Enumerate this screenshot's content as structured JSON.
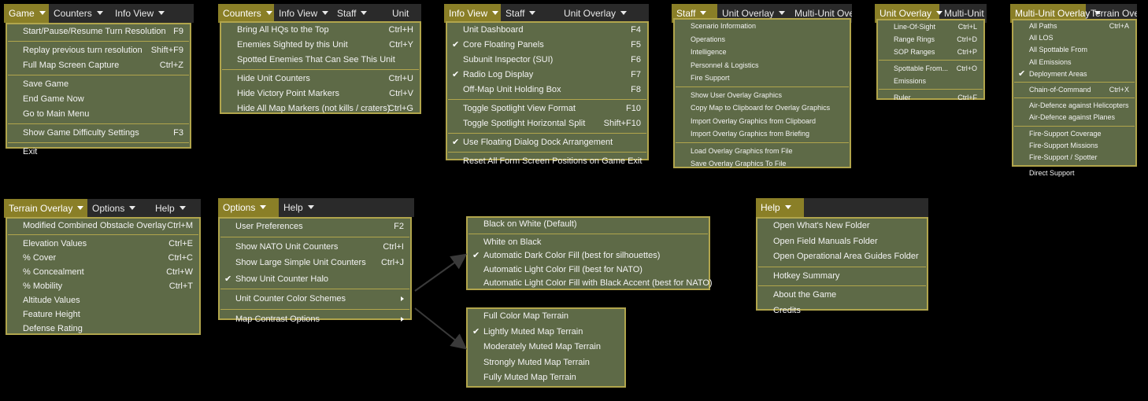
{
  "panels": [
    {
      "id": "game",
      "menubar": [
        {
          "label": "Game",
          "active": true
        },
        {
          "label": "Counters"
        },
        {
          "label": "Info View"
        }
      ],
      "items": [
        {
          "label": "Start/Pause/Resume Turn Resolution",
          "shortcut": "F9"
        },
        {
          "sep": true
        },
        {
          "label": "Replay previous turn resolution",
          "shortcut": "Shift+F9"
        },
        {
          "label": "Full Map Screen Capture",
          "shortcut": "Ctrl+Z"
        },
        {
          "sep": true
        },
        {
          "label": "Save Game"
        },
        {
          "label": "End Game Now"
        },
        {
          "label": "Go to Main Menu"
        },
        {
          "sep": true
        },
        {
          "label": "Show Game Difficulty Settings",
          "shortcut": "F3"
        },
        {
          "sep": true
        },
        {
          "label": "Exit"
        }
      ]
    },
    {
      "id": "counters",
      "menubar": [
        {
          "label": "Counters",
          "active": true
        },
        {
          "label": "Info View"
        },
        {
          "label": "Staff"
        },
        {
          "label": "Unit",
          "noarrow": true
        }
      ],
      "items": [
        {
          "label": "Bring All HQs to the Top",
          "shortcut": "Ctrl+H"
        },
        {
          "label": "Enemies Sighted by this Unit",
          "shortcut": "Ctrl+Y"
        },
        {
          "label": "Spotted Enemies That Can See This Unit"
        },
        {
          "sep": true
        },
        {
          "label": "Hide Unit Counters",
          "shortcut": "Ctrl+U"
        },
        {
          "label": "Hide Victory Point Markers",
          "shortcut": "Ctrl+V"
        },
        {
          "label": "Hide All Map Markers (not kills / craters)",
          "shortcut": "Ctrl+G"
        }
      ]
    },
    {
      "id": "infoview",
      "menubar": [
        {
          "label": "Info View",
          "active": true
        },
        {
          "label": "Staff"
        },
        {
          "label": "Unit Overlay"
        }
      ],
      "items": [
        {
          "label": "Unit Dashboard",
          "shortcut": "F4"
        },
        {
          "label": "Core Floating Panels",
          "shortcut": "F5",
          "checked": true
        },
        {
          "label": "Subunit Inspector (SUI)",
          "shortcut": "F6"
        },
        {
          "label": "Radio Log Display",
          "shortcut": "F7",
          "checked": true
        },
        {
          "label": "Off-Map Unit Holding Box",
          "shortcut": "F8"
        },
        {
          "sep": true
        },
        {
          "label": "Toggle Spotlight View Format",
          "shortcut": "F10"
        },
        {
          "label": "Toggle Spotlight Horizontal Split",
          "shortcut": "Shift+F10"
        },
        {
          "sep": true
        },
        {
          "label": "Use Floating Dialog Dock Arrangement",
          "checked": true
        },
        {
          "sep": true
        },
        {
          "label": "Reset All Form Screen Positions on Game Exit"
        }
      ]
    },
    {
      "id": "staff",
      "menubar": [
        {
          "label": "Staff",
          "active": true
        },
        {
          "label": "Unit Overlay"
        },
        {
          "label": "Multi-Unit Ove",
          "noarrow": true
        }
      ],
      "items": [
        {
          "label": "Scenario Information"
        },
        {
          "label": "Operations"
        },
        {
          "label": "Intelligence"
        },
        {
          "label": "Personnel & Logistics"
        },
        {
          "label": "Fire Support"
        },
        {
          "sep": true
        },
        {
          "label": "Show User Overlay Graphics"
        },
        {
          "label": "Copy Map to Clipboard for Overlay Graphics"
        },
        {
          "label": "Import Overlay Graphics from Clipboard"
        },
        {
          "label": "Import Overlay Graphics from Briefing"
        },
        {
          "sep": true
        },
        {
          "label": "Load Overlay Graphics from File"
        },
        {
          "label": "Save Overlay Graphics To File"
        }
      ]
    },
    {
      "id": "unitoverlay",
      "menubar": [
        {
          "label": "Unit Overlay",
          "active": true
        },
        {
          "label": "Multi-Unit",
          "noarrow": true
        }
      ],
      "items": [
        {
          "label": "Line-Of-Sight",
          "shortcut": "Ctrl+L"
        },
        {
          "label": "Range Rings",
          "shortcut": "Ctrl+D"
        },
        {
          "label": "SOP Ranges",
          "shortcut": "Ctrl+P"
        },
        {
          "sep": true
        },
        {
          "label": "Spottable From...",
          "shortcut": "Ctrl+O"
        },
        {
          "label": "Emissions"
        },
        {
          "sep": true
        },
        {
          "label": "Ruler",
          "shortcut": "Ctrl+F"
        }
      ]
    },
    {
      "id": "multiunit",
      "menubar": [
        {
          "label": "Multi-Unit Overlay",
          "active": true
        },
        {
          "label": "Terrain Ove",
          "noarrow": true
        }
      ],
      "items": [
        {
          "label": "All Paths",
          "shortcut": "Ctrl+A"
        },
        {
          "label": "All LOS"
        },
        {
          "label": "All Spottable From"
        },
        {
          "label": "All Emissions"
        },
        {
          "label": "Deployment Areas",
          "checked": true
        },
        {
          "sep": true
        },
        {
          "label": "Chain-of-Command",
          "shortcut": "Ctrl+X"
        },
        {
          "sep": true
        },
        {
          "label": "Air-Defence against Helicopters"
        },
        {
          "label": "Air-Defence against Planes"
        },
        {
          "sep": true
        },
        {
          "label": "Fire-Support Coverage"
        },
        {
          "label": "Fire-Support Missions"
        },
        {
          "label": "Fire-Support / Spotter"
        },
        {
          "sep": true
        },
        {
          "label": "Direct Support"
        }
      ]
    },
    {
      "id": "terrain",
      "menubar": [
        {
          "label": "Terrain Overlay",
          "active": true
        },
        {
          "label": "Options"
        },
        {
          "label": "Help"
        }
      ],
      "items": [
        {
          "label": "Modified Combined Obstacle Overlay",
          "shortcut": "Ctrl+M"
        },
        {
          "sep": true
        },
        {
          "label": "Elevation Values",
          "shortcut": "Ctrl+E"
        },
        {
          "label": "% Cover",
          "shortcut": "Ctrl+C"
        },
        {
          "label": "% Concealment",
          "shortcut": "Ctrl+W"
        },
        {
          "label": "% Mobility",
          "shortcut": "Ctrl+T"
        },
        {
          "label": "Altitude Values"
        },
        {
          "label": "Feature Height"
        },
        {
          "label": "Defense Rating"
        }
      ]
    },
    {
      "id": "options",
      "menubar": [
        {
          "label": "Options",
          "active": true
        },
        {
          "label": "Help"
        }
      ],
      "items": [
        {
          "label": "User Preferences",
          "shortcut": "F2"
        },
        {
          "sep": true
        },
        {
          "label": "Show NATO Unit Counters",
          "shortcut": "Ctrl+I"
        },
        {
          "label": "Show Large Simple Unit Counters",
          "shortcut": "Ctrl+J"
        },
        {
          "label": "Show Unit Counter Halo",
          "checked": true
        },
        {
          "sep": true
        },
        {
          "label": "Unit Counter Color Schemes",
          "submenu": true
        },
        {
          "sep": true
        },
        {
          "label": "Map Contrast Options",
          "submenu": true
        }
      ]
    },
    {
      "id": "colorschemes",
      "items": [
        {
          "label": "Black on White (Default)"
        },
        {
          "sep": true
        },
        {
          "label": "White on Black"
        },
        {
          "label": "Automatic Dark Color Fill (best for silhouettes)",
          "checked": true
        },
        {
          "label": "Automatic Light Color Fill (best for NATO)"
        },
        {
          "label": "Automatic Light Color Fill with Black Accent (best for NATO)"
        }
      ]
    },
    {
      "id": "mapcontrast",
      "items": [
        {
          "label": "Full Color Map Terrain"
        },
        {
          "label": "Lightly Muted Map Terrain",
          "checked": true
        },
        {
          "label": "Moderately Muted Map Terrain"
        },
        {
          "label": "Strongly Muted Map Terrain"
        },
        {
          "label": "Fully Muted Map Terrain"
        }
      ]
    },
    {
      "id": "help",
      "menubar": [
        {
          "label": "Help",
          "active": true
        }
      ],
      "items": [
        {
          "label": "Open What's New Folder"
        },
        {
          "label": "Open Field Manuals Folder"
        },
        {
          "label": "Open Operational Area Guides Folder"
        },
        {
          "sep": true
        },
        {
          "label": "Hotkey Summary"
        },
        {
          "sep": true
        },
        {
          "label": "About the Game"
        },
        {
          "label": "Credits"
        }
      ]
    }
  ],
  "colors": {
    "accent": "#8a7f27",
    "menu_bg": "#5e6a47",
    "border": "#b1a54c",
    "bar_bg": "#2a2a2a"
  },
  "icons": {
    "check": "check-icon",
    "submenu": "submenu-arrow-icon",
    "dropdown": "chevron-down-icon"
  }
}
